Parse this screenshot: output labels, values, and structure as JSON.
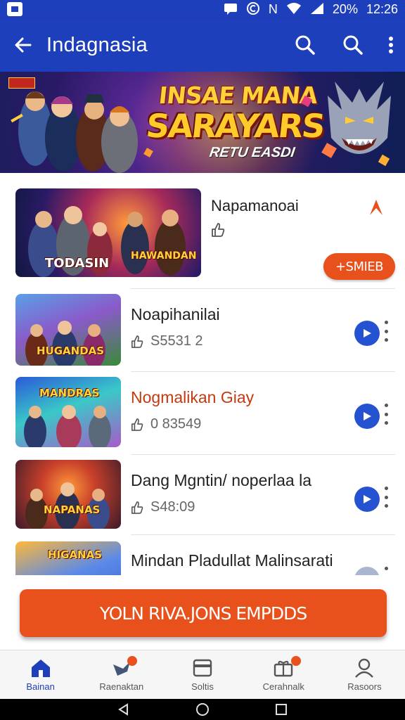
{
  "status_bar": {
    "battery": "20%",
    "time": "12:26",
    "network": "N"
  },
  "app_bar": {
    "title": "Indagnasia"
  },
  "banner": {
    "line1": "INSAE MANA",
    "line2": "SARAYARS",
    "line3": "RETU EASDI"
  },
  "featured": {
    "title": "Napamanoai",
    "thumb_caption_left": "TODASIN",
    "thumb_caption_right": "HAWANDAN",
    "install_label": "+SMIEB"
  },
  "rows": [
    {
      "title": "Noapihanilai",
      "meta": "S5531 2",
      "thumb_caption": "HUGANDAS"
    },
    {
      "title": "Nogmalikan Giay",
      "meta": "0 83549",
      "thumb_caption": "MANDRAS"
    },
    {
      "title": "Dang Mgntin/ noperlaa la",
      "meta": "S48:09",
      "thumb_caption": "NAPANAS"
    },
    {
      "title": "Mindan Pladullat Malinsarati",
      "meta": "",
      "thumb_caption": "HIGANAS"
    }
  ],
  "cta": {
    "label": "YOLN RIVA.JONS EMPDDS"
  },
  "bottom_nav": {
    "items": [
      {
        "label": "Bainan",
        "icon": "home-icon",
        "active": true
      },
      {
        "label": "Raenaktan",
        "icon": "bird-icon",
        "active": false
      },
      {
        "label": "Soltis",
        "icon": "card-icon",
        "active": false
      },
      {
        "label": "Cerahnalk",
        "icon": "gift-icon",
        "active": false
      },
      {
        "label": "Rasoors",
        "icon": "person-icon",
        "active": false
      }
    ]
  },
  "colors": {
    "primary": "#1e3fbb",
    "accent": "#e8501c",
    "play": "#2552d0"
  }
}
